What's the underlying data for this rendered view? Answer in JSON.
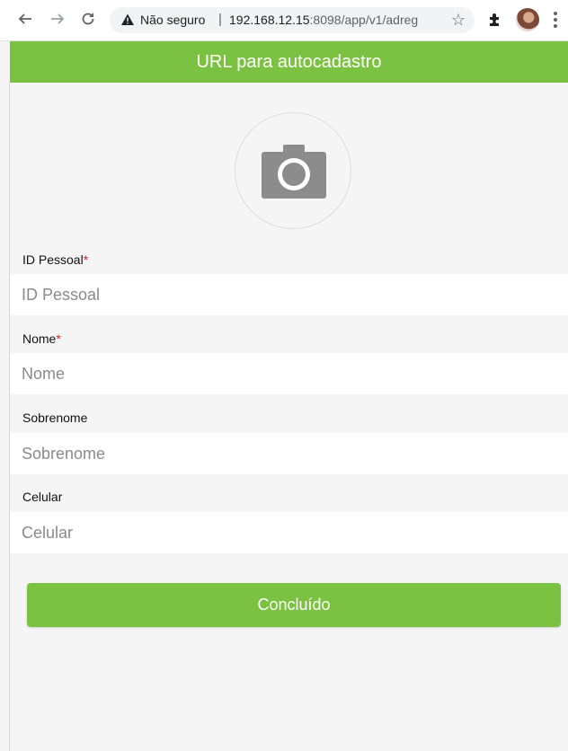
{
  "browser": {
    "security_text": "Não seguro",
    "url_host": "192.168.12.15",
    "url_rest": ":8098/app/v1/adreg",
    "nav_icons": [
      "back-arrow-icon",
      "forward-arrow-icon",
      "reload-icon"
    ],
    "toolbar_icons": [
      "bookmark-star-icon",
      "extensions-puzzle-icon",
      "profile-avatar",
      "menu-dots-icon"
    ]
  },
  "header": {
    "title": "URL para autocadastro",
    "accent_color": "#7cc242"
  },
  "photo": {
    "icon": "camera-icon"
  },
  "form": {
    "fields": [
      {
        "label": "ID Pessoal",
        "required_mark": "*",
        "placeholder": "ID Pessoal",
        "value": ""
      },
      {
        "label": "Nome",
        "required_mark": "*",
        "placeholder": "Nome",
        "value": ""
      },
      {
        "label": "Sobrenome",
        "required_mark": "",
        "placeholder": "Sobrenome",
        "value": ""
      },
      {
        "label": "Celular",
        "required_mark": "",
        "placeholder": "Celular",
        "value": ""
      }
    ],
    "submit_label": "Concluído"
  }
}
